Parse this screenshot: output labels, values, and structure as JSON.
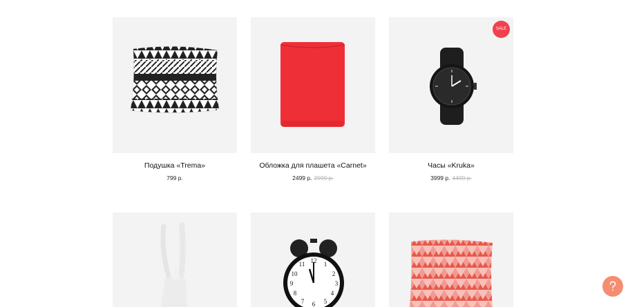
{
  "products_row1": [
    {
      "title": "Подушка «Trema»",
      "price": "799 р.",
      "old_price": ""
    },
    {
      "title": "Обложка для плашета «Carnet»",
      "price": "2499 р.",
      "old_price": "2999 р."
    },
    {
      "title": "Часы «Kruka»",
      "price": "3999 р.",
      "old_price": "4499 р.",
      "badge": "SALE"
    }
  ],
  "products_row2": [
    {
      "name": "antelope-figurine"
    },
    {
      "name": "alarm-clock"
    },
    {
      "name": "pink-pillow"
    }
  ],
  "colors": {
    "badge": "#f1414d",
    "help": "#f58d72",
    "card_bg": "#f3f3f3"
  },
  "icons": {
    "help": "question-mark-icon"
  }
}
